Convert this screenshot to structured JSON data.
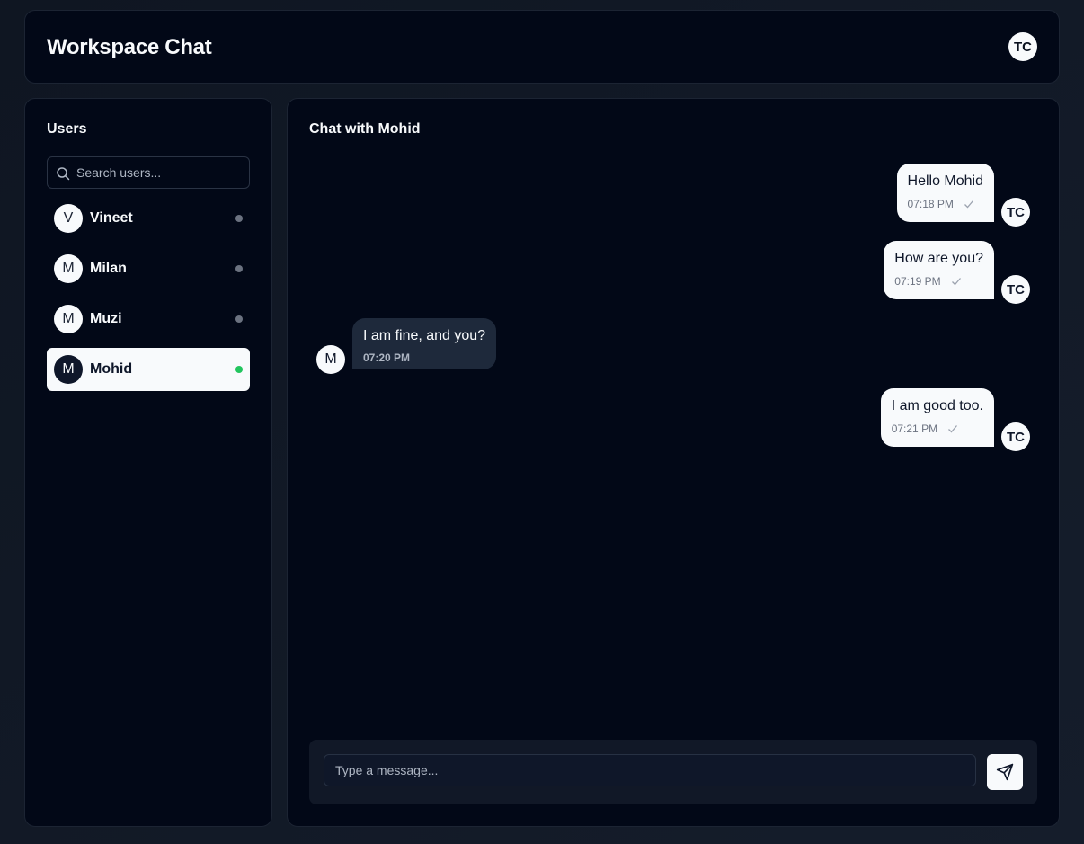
{
  "app": {
    "title": "Workspace Chat",
    "user_initials": "TC"
  },
  "sidebar": {
    "title": "Users",
    "search_placeholder": "Search users...",
    "users": [
      {
        "initial": "V",
        "name": "Vineet",
        "status": "offline",
        "active": false
      },
      {
        "initial": "M",
        "name": "Milan",
        "status": "offline",
        "active": false
      },
      {
        "initial": "M",
        "name": "Muzi",
        "status": "offline",
        "active": false
      },
      {
        "initial": "M",
        "name": "Mohid",
        "status": "online",
        "active": true
      }
    ]
  },
  "chat": {
    "title": "Chat with Mohid",
    "messages": [
      {
        "direction": "out",
        "text": "Hello Mohid",
        "time": "07:18 PM",
        "avatar": "TC",
        "read_icon": "check-icon"
      },
      {
        "direction": "out",
        "text": "How are you?",
        "time": "07:19 PM",
        "avatar": "TC",
        "read_icon": "check-icon"
      },
      {
        "direction": "in",
        "text": "I am fine, and you?",
        "time": "07:20 PM",
        "avatar": "M"
      },
      {
        "direction": "out",
        "text": "I am good too.",
        "time": "07:21 PM",
        "avatar": "TC",
        "read_icon": "check-icon"
      }
    ],
    "composer_placeholder": "Type a message...",
    "send_icon": "send-icon"
  },
  "colors": {
    "background": "#020817",
    "panel_border": "#1c2433",
    "outgoing_bubble": "#f8fafc",
    "incoming_bubble": "#1e293b",
    "online": "#22c55e",
    "offline": "#6b7280"
  }
}
